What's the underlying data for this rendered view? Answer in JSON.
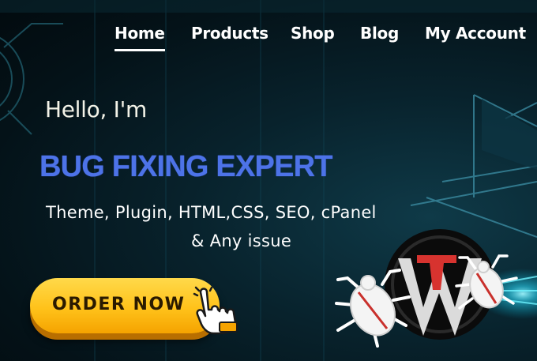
{
  "nav": {
    "items": [
      {
        "label": "Home",
        "active": true
      },
      {
        "label": "Products",
        "active": false
      },
      {
        "label": "Shop",
        "active": false
      },
      {
        "label": "Blog",
        "active": false
      },
      {
        "label": "My Account",
        "active": false
      }
    ]
  },
  "hero": {
    "greeting": "Hello, I'm",
    "headline": "BUG FIXING EXPERT",
    "services_line1": "Theme, Plugin,  HTML,CSS, SEO, cPanel",
    "services_line2": "& Any issue"
  },
  "cta": {
    "label": "ORDER NOW"
  },
  "icons": {
    "hand": "pointing-hand-icon",
    "bug": "bug-icon",
    "wordpress": "wordpress-logo-icon"
  },
  "colors": {
    "background": "#06161c",
    "headline": "#4d73e8",
    "button": "#ffc21a",
    "accent_cyan": "#35e6ff"
  }
}
